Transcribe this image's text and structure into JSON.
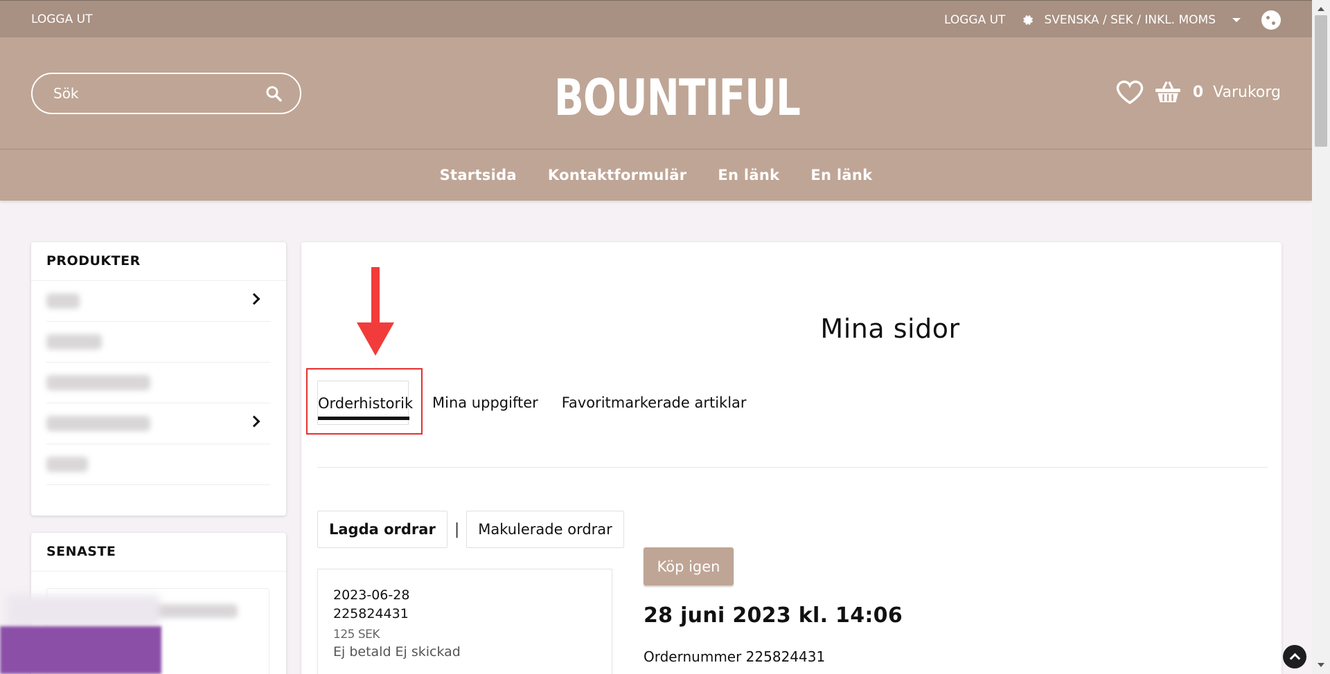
{
  "topbar": {
    "left_logout": "LOGGA UT",
    "right_logout": "LOGGA UT",
    "locale": "SVENSKA / SEK / INKL. MOMS"
  },
  "header": {
    "search_placeholder": "Sök",
    "logo": "BOUNTIFUL",
    "cart_count": "0",
    "cart_label": "Varukorg"
  },
  "nav": {
    "items": [
      "Startsida",
      "Kontaktformulär",
      "En länk",
      "En länk"
    ]
  },
  "sidebar": {
    "products_title": "PRODUKTER",
    "latest_title": "SENASTE"
  },
  "main": {
    "title": "Mina sidor",
    "tabs": [
      "Orderhistorik",
      "Mina uppgifter",
      "Favoritmarkerade artiklar"
    ],
    "subtabs": [
      "Lagda ordrar",
      "|",
      "Makulerade ordrar"
    ],
    "order": {
      "date": "2023-06-28",
      "number": "225824431",
      "amount": "125 SEK",
      "status": "Ej betald Ej skickad"
    },
    "buy_again": "Köp igen",
    "order_datetime": "28 juni 2023 kl. 14:06",
    "order_number_line": "Ordernummer 225824431"
  },
  "colors": {
    "topbar": "#a89082",
    "header": "#bfa595",
    "annotation": "#e53030"
  }
}
